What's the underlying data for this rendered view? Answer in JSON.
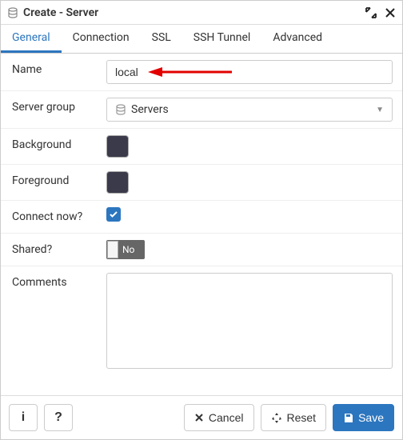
{
  "title": "Create - Server",
  "tabs": [
    "General",
    "Connection",
    "SSL",
    "SSH Tunnel",
    "Advanced"
  ],
  "activeTab": 0,
  "fields": {
    "name_label": "Name",
    "name_value": "local",
    "server_group_label": "Server group",
    "server_group_value": "Servers",
    "background_label": "Background",
    "foreground_label": "Foreground",
    "connect_now_label": "Connect now?",
    "shared_label": "Shared?",
    "shared_value": "No",
    "comments_label": "Comments",
    "comments_value": ""
  },
  "colors": {
    "background_swatch": "#3a3a4a",
    "foreground_swatch": "#3a3a4a"
  },
  "footer": {
    "cancel": "Cancel",
    "reset": "Reset",
    "save": "Save"
  }
}
